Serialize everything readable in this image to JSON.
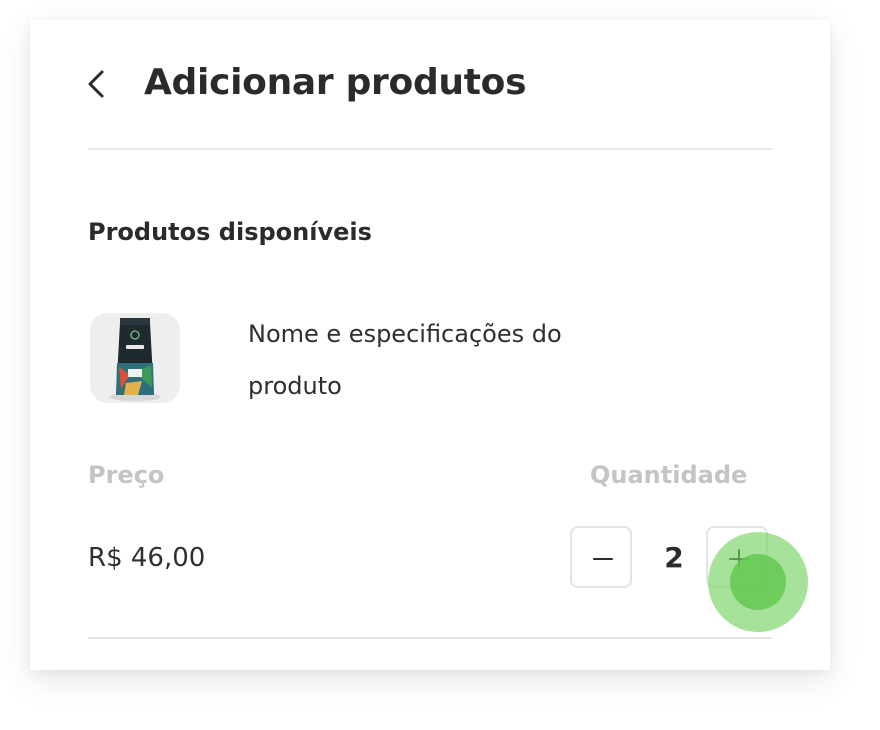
{
  "header": {
    "title": "Adicionar produtos",
    "back_icon": "chevron-left-icon"
  },
  "section": {
    "title": "Produtos disponíveis"
  },
  "product": {
    "name_line1": "Nome e especificações do",
    "name_line2": "produto",
    "image": "coffee-bag-thumbnail",
    "price_label": "Preço",
    "price_value": "R$ 46,00",
    "quantity_label": "Quantidade",
    "quantity_value": "2",
    "decrement_icon": "minus-icon",
    "increment_icon": "plus-icon"
  },
  "colors": {
    "text_primary": "#2b2b2b",
    "text_muted": "#c4c4c4",
    "divider": "#e6e6e6",
    "touch_indicator": "#78d264"
  }
}
